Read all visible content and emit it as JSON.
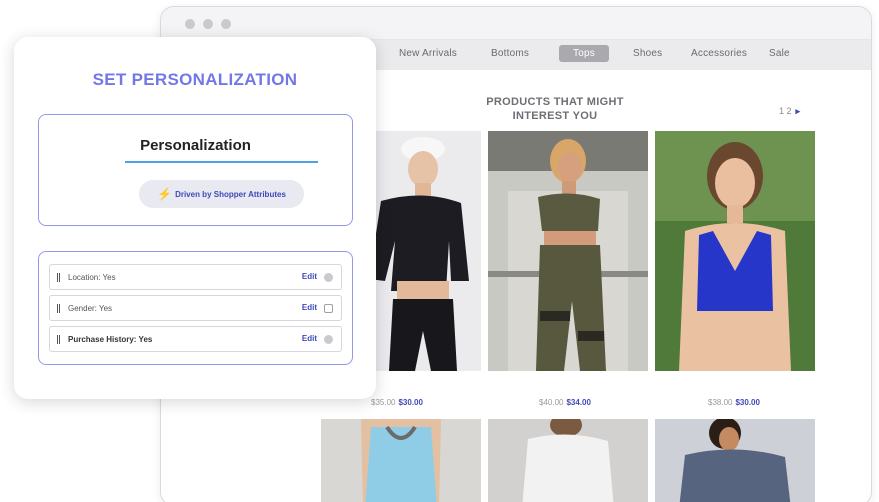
{
  "browser": {
    "nav": {
      "items": [
        "New Arrivals",
        "Bottoms",
        "Tops",
        "Shoes",
        "Accessories",
        "Sale"
      ],
      "active": "Tops"
    }
  },
  "products": {
    "title_line1": "PRODUCTS THAT MIGHT",
    "title_line2": "INTEREST YOU",
    "pager": "1  2",
    "row1": [
      {
        "price_old": "$35.00",
        "price_sale": "$30.00"
      },
      {
        "price_old": "$40.00",
        "price_sale": "$34.00"
      },
      {
        "price_old": "$38.00",
        "price_sale": "$30.00"
      }
    ]
  },
  "personalization_card": {
    "title": "SET PERSONALIZATION",
    "box_title": "Personalization",
    "driven_by": "Driven by Shopper Attributes",
    "attributes": [
      {
        "label": "Location: Yes",
        "action": "Edit"
      },
      {
        "label": "Gender: Yes",
        "action": "Edit"
      },
      {
        "label": "Purchase History: Yes",
        "action": "Edit"
      }
    ]
  },
  "colors": {
    "accent": "#7378e6",
    "link": "#3d4ab8",
    "border": "#9597ee",
    "underline": "#4aa2e8"
  }
}
